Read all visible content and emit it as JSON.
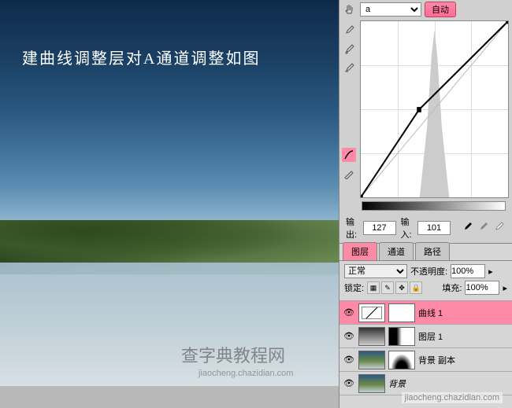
{
  "canvas": {
    "annotation": "建曲线调整层对A通道调整如图"
  },
  "curves": {
    "channel": "a",
    "auto_label": "自动",
    "output_label": "输出:",
    "output_value": "127",
    "input_label": "输入:",
    "input_value": "101"
  },
  "layers_panel": {
    "tabs": {
      "layers": "图层",
      "channels": "通道",
      "paths": "路径"
    },
    "blend_label": "正常",
    "opacity_label": "不透明度:",
    "opacity_value": "100%",
    "lock_label": "锁定:",
    "fill_label": "填充:",
    "fill_value": "100%",
    "layers": [
      {
        "name": "曲线 1",
        "selected": true,
        "type": "curves"
      },
      {
        "name": "图层 1",
        "selected": false,
        "type": "grad"
      },
      {
        "name": "背景 副本",
        "selected": false,
        "type": "img"
      },
      {
        "name": "背景",
        "selected": false,
        "type": "img"
      }
    ]
  },
  "watermark": {
    "site_name": "查字典教程网",
    "domain": "jiaocheng.chazidian.com"
  },
  "chart_data": {
    "type": "line",
    "title": "Curves adjustment (a channel)",
    "xlabel": "输入",
    "ylabel": "输出",
    "xlim": [
      0,
      255
    ],
    "ylim": [
      0,
      255
    ],
    "baseline": {
      "x": [
        0,
        255
      ],
      "y": [
        0,
        255
      ]
    },
    "curve_points": [
      {
        "x": 0,
        "y": 0
      },
      {
        "x": 101,
        "y": 127
      },
      {
        "x": 255,
        "y": 255
      }
    ],
    "active_point": {
      "input": 101,
      "output": 127
    }
  }
}
